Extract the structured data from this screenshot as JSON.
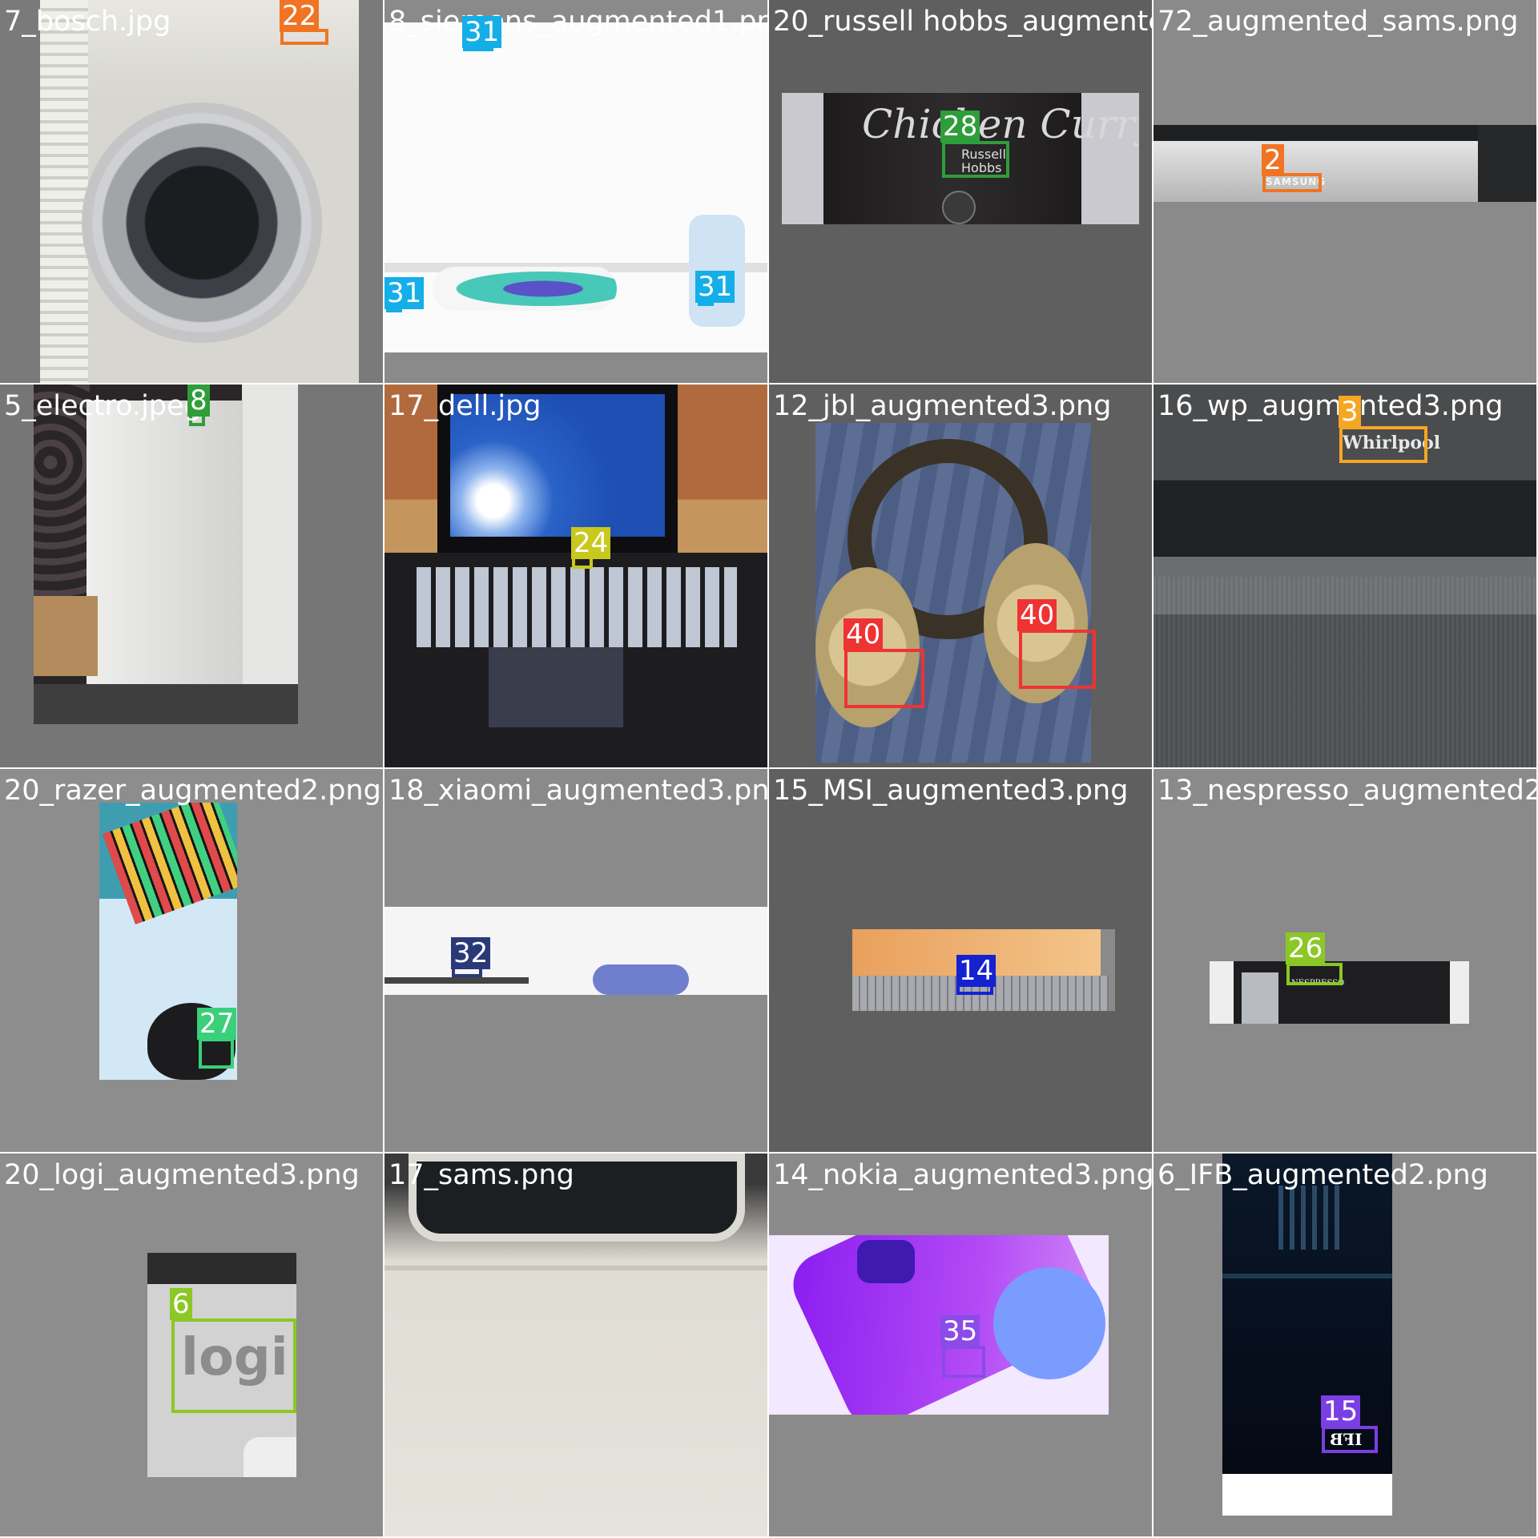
{
  "colors": {
    "c2": "#f07423",
    "c3": "#f5a623",
    "c6": "#8bc825",
    "c8": "#2e9e3a",
    "c14": "#1422d2",
    "c15": "#7a3fe3",
    "c22": "#f07423",
    "c24": "#c8c81e",
    "c26": "#8bc825",
    "c27": "#3ad07a",
    "c28": "#2e9e3a",
    "c31": "#14aee8",
    "c32": "#2a3a78",
    "c35": "#8a4be8",
    "c40": "#ee3333"
  },
  "tiles": [
    {
      "filename": "7_bosch.jpg",
      "labels": [
        "22"
      ],
      "logo": "BOSCH"
    },
    {
      "filename": "8_siemens_augmented1.png",
      "labels": [
        "31",
        "31",
        "31"
      ]
    },
    {
      "filename": "20_russell hobbs_augmented2.png",
      "labels": [
        "28"
      ],
      "mug_text": "Chicken Curry",
      "logo": "Russell Hobbs"
    },
    {
      "filename": "72_augmented_sams.png",
      "labels": [
        "2"
      ],
      "logo": "SAMSUNG"
    },
    {
      "filename": "5_electro.jpeg",
      "labels": [
        "8"
      ]
    },
    {
      "filename": "17_dell.jpg",
      "labels": [
        "24"
      ],
      "logo": "DELL"
    },
    {
      "filename": "12_jbl_augmented3.png",
      "labels": [
        "40",
        "40"
      ]
    },
    {
      "filename": "16_wp_augmented3.png",
      "labels": [
        "3"
      ],
      "logo": "Whirlpool"
    },
    {
      "filename": "20_razer_augmented2.png",
      "labels": [
        "27"
      ]
    },
    {
      "filename": "18_xiaomi_augmented3.png",
      "labels": [
        "32"
      ]
    },
    {
      "filename": "15_MSI_augmented3.png",
      "labels": [
        "14"
      ]
    },
    {
      "filename": "13_nespresso_augmented2.png",
      "labels": [
        "26"
      ],
      "logo": "NESPRESSO"
    },
    {
      "filename": "20_logi_augmented3.png",
      "labels": [
        "6"
      ],
      "logo": "logi"
    },
    {
      "filename": "17_sams.png",
      "labels": []
    },
    {
      "filename": "14_nokia_augmented3.png",
      "labels": [
        "35"
      ]
    },
    {
      "filename": "6_IFB_augmented2.png",
      "labels": [
        "15"
      ],
      "logo": "IFB"
    }
  ]
}
